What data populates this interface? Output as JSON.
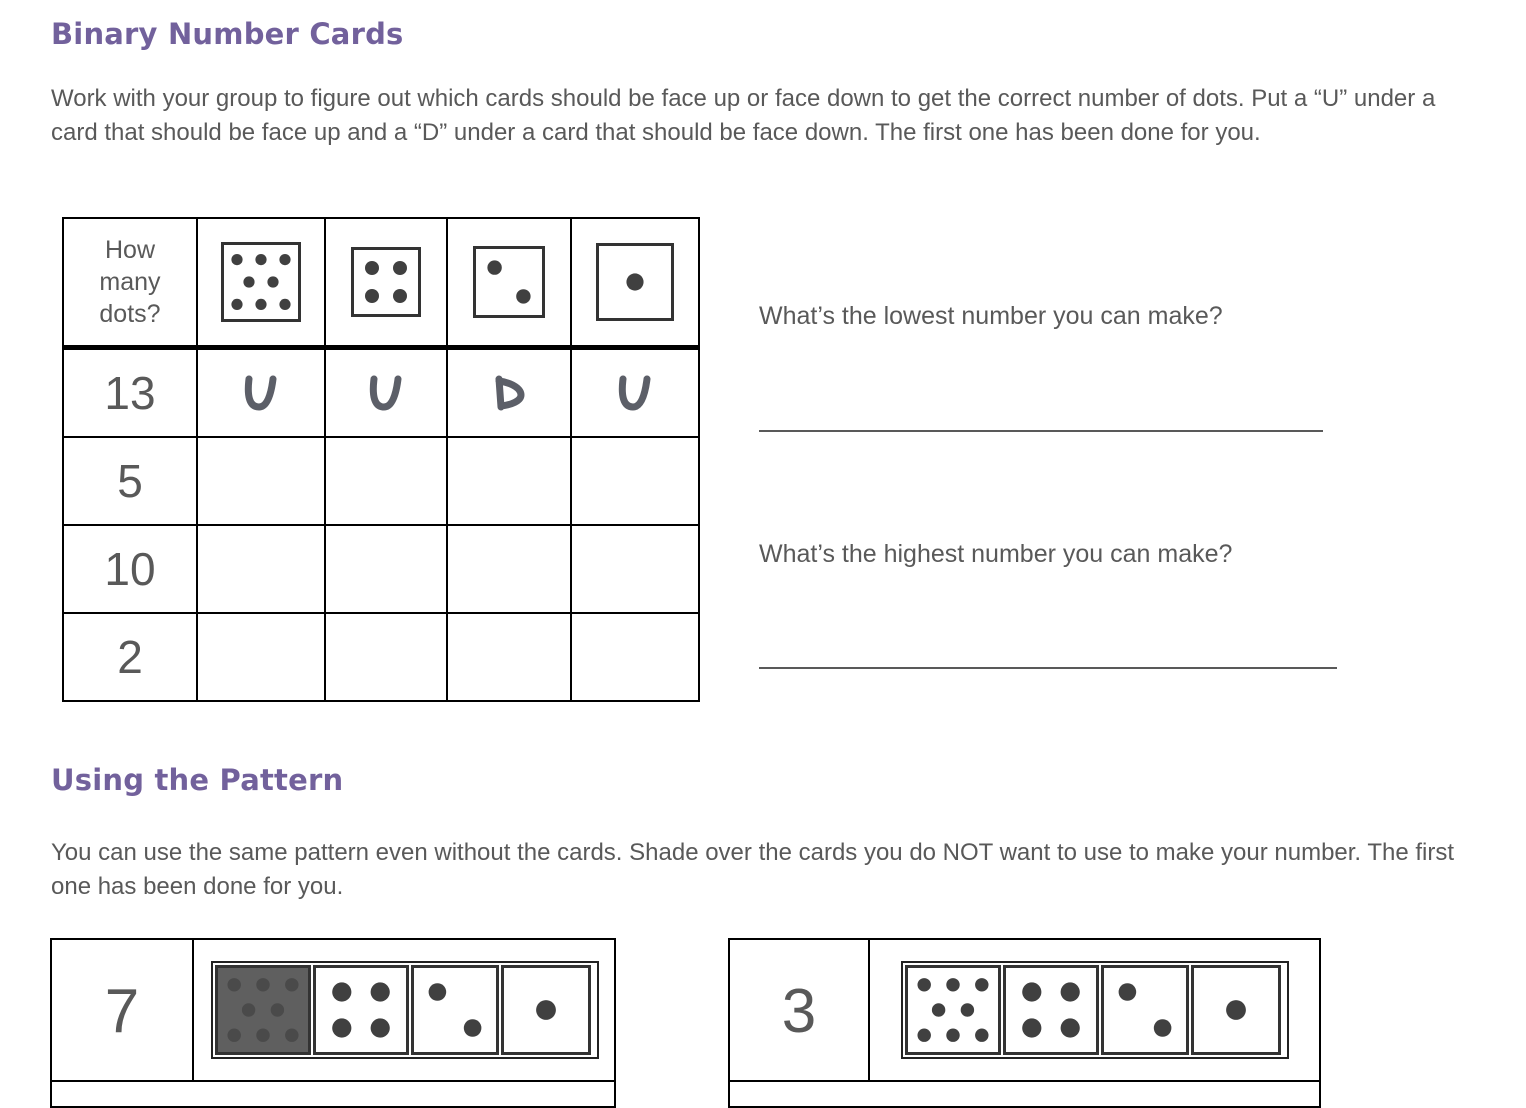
{
  "section1": {
    "title": "Binary Number Cards",
    "instructions": "Work with your group to figure out which cards should be face up or face down to get the correct number of dots.  Put a “U” under a card that should be face up and a “D” under a card that should be face down.  The first one has been done for you."
  },
  "table": {
    "header_label": "How many dots?",
    "cards": [
      8,
      4,
      2,
      1
    ],
    "rows": [
      {
        "number": "13",
        "marks": [
          "U",
          "U",
          "D",
          "U"
        ]
      },
      {
        "number": "5",
        "marks": [
          "",
          "",
          "",
          ""
        ]
      },
      {
        "number": "10",
        "marks": [
          "",
          "",
          "",
          ""
        ]
      },
      {
        "number": "2",
        "marks": [
          "",
          "",
          "",
          ""
        ]
      }
    ]
  },
  "questions": {
    "lowest": "What’s the lowest number you can make?",
    "highest": "What’s the highest number you can make?"
  },
  "section2": {
    "title": "Using the Pattern",
    "instructions": "You can use the same pattern even without the cards.  Shade over the cards you do NOT want to use to make your number.  The first one has been done for you."
  },
  "patterns": [
    {
      "number": "7",
      "shaded": [
        true,
        false,
        false,
        false
      ]
    },
    {
      "number": "3",
      "shaded": [
        false,
        false,
        false,
        false
      ]
    }
  ],
  "colors": {
    "heading": "#72619c",
    "text": "#595959",
    "dot": "#404040",
    "shade": "#5f5f5f"
  }
}
